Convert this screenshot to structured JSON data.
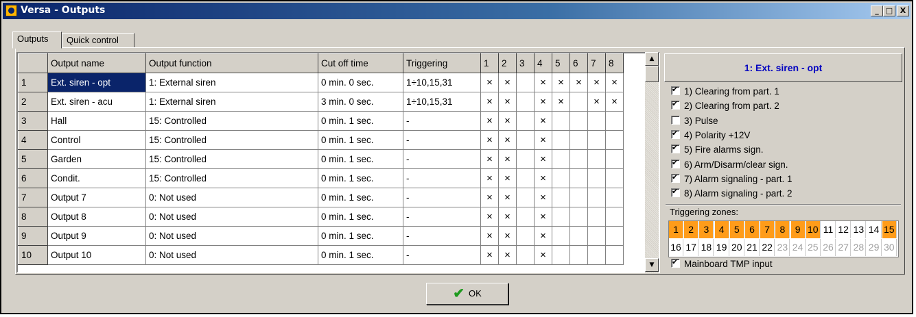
{
  "window": {
    "title": "Versa - Outputs",
    "controls": [
      "_",
      "□",
      "X"
    ]
  },
  "tabs": [
    {
      "label": "Outputs",
      "active": true
    },
    {
      "label": "Quick control",
      "active": false
    }
  ],
  "table": {
    "columns": [
      "",
      "Output name",
      "Output function",
      "Cut off time",
      "Triggering",
      "1",
      "2",
      "3",
      "4",
      "5",
      "6",
      "7",
      "8"
    ],
    "rows": [
      {
        "num": "1",
        "name": "Ext. siren - opt",
        "function": "1: External siren",
        "cutoff": "0 min. 0 sec.",
        "triggering": "1÷10,15,31",
        "marks": [
          "×",
          "×",
          "",
          "×",
          "×",
          "×",
          "×",
          "×"
        ]
      },
      {
        "num": "2",
        "name": "Ext. siren - acu",
        "function": "1: External siren",
        "cutoff": "3 min. 0 sec.",
        "triggering": "1÷10,15,31",
        "marks": [
          "×",
          "×",
          "",
          "×",
          "×",
          "",
          "×",
          "×"
        ]
      },
      {
        "num": "3",
        "name": "Hall",
        "function": "15: Controlled",
        "cutoff": "0 min. 1 sec.",
        "triggering": "-",
        "marks": [
          "×",
          "×",
          "",
          "×",
          "",
          "",
          "",
          ""
        ]
      },
      {
        "num": "4",
        "name": "Control",
        "function": "15: Controlled",
        "cutoff": "0 min. 1 sec.",
        "triggering": "-",
        "marks": [
          "×",
          "×",
          "",
          "×",
          "",
          "",
          "",
          ""
        ]
      },
      {
        "num": "5",
        "name": "Garden",
        "function": "15: Controlled",
        "cutoff": "0 min. 1 sec.",
        "triggering": "-",
        "marks": [
          "×",
          "×",
          "",
          "×",
          "",
          "",
          "",
          ""
        ]
      },
      {
        "num": "6",
        "name": "Condit.",
        "function": "15: Controlled",
        "cutoff": "0 min. 1 sec.",
        "triggering": "-",
        "marks": [
          "×",
          "×",
          "",
          "×",
          "",
          "",
          "",
          ""
        ]
      },
      {
        "num": "7",
        "name": "Output 7",
        "function": "0: Not used",
        "cutoff": "0 min. 1 sec.",
        "triggering": "-",
        "marks": [
          "×",
          "×",
          "",
          "×",
          "",
          "",
          "",
          ""
        ]
      },
      {
        "num": "8",
        "name": "Output 8",
        "function": "0: Not used",
        "cutoff": "0 min. 1 sec.",
        "triggering": "-",
        "marks": [
          "×",
          "×",
          "",
          "×",
          "",
          "",
          "",
          ""
        ]
      },
      {
        "num": "9",
        "name": "Output 9",
        "function": "0: Not used",
        "cutoff": "0 min. 1 sec.",
        "triggering": "-",
        "marks": [
          "×",
          "×",
          "",
          "×",
          "",
          "",
          "",
          ""
        ]
      },
      {
        "num": "10",
        "name": "Output 10",
        "function": "0: Not used",
        "cutoff": "0 min. 1 sec.",
        "triggering": "-",
        "marks": [
          "×",
          "×",
          "",
          "×",
          "",
          "",
          "",
          ""
        ]
      }
    ],
    "selected_row": 1
  },
  "side": {
    "header": "1: Ext. siren - opt",
    "options": [
      {
        "label": "1) Clearing from part. 1",
        "checked": true
      },
      {
        "label": "2) Clearing from part. 2",
        "checked": true
      },
      {
        "label": "3) Pulse",
        "checked": false
      },
      {
        "label": "4) Polarity +12V",
        "checked": true
      },
      {
        "label": "5) Fire alarms sign.",
        "checked": true
      },
      {
        "label": "6) Arm/Disarm/clear sign.",
        "checked": true
      },
      {
        "label": "7) Alarm signaling - part.  1",
        "checked": true
      },
      {
        "label": "8) Alarm signaling - part.  2",
        "checked": true
      }
    ],
    "zones_label": "Triggering zones:",
    "zones": [
      {
        "n": "1",
        "on": true
      },
      {
        "n": "2",
        "on": true
      },
      {
        "n": "3",
        "on": true
      },
      {
        "n": "4",
        "on": true
      },
      {
        "n": "5",
        "on": true
      },
      {
        "n": "6",
        "on": true
      },
      {
        "n": "7",
        "on": true
      },
      {
        "n": "8",
        "on": true
      },
      {
        "n": "9",
        "on": true
      },
      {
        "n": "10",
        "on": true
      },
      {
        "n": "11",
        "on": false
      },
      {
        "n": "12",
        "on": false
      },
      {
        "n": "13",
        "on": false
      },
      {
        "n": "14",
        "on": false
      },
      {
        "n": "15",
        "on": true
      },
      {
        "n": "16",
        "on": false
      },
      {
        "n": "17",
        "on": false
      },
      {
        "n": "18",
        "on": false
      },
      {
        "n": "19",
        "on": false
      },
      {
        "n": "20",
        "on": false
      },
      {
        "n": "21",
        "on": false
      },
      {
        "n": "22",
        "on": false
      },
      {
        "n": "23",
        "on": false,
        "dim": true
      },
      {
        "n": "24",
        "on": false,
        "dim": true
      },
      {
        "n": "25",
        "on": false,
        "dim": true
      },
      {
        "n": "26",
        "on": false,
        "dim": true
      },
      {
        "n": "27",
        "on": false,
        "dim": true
      },
      {
        "n": "28",
        "on": false,
        "dim": true
      },
      {
        "n": "29",
        "on": false,
        "dim": true
      },
      {
        "n": "30",
        "on": false,
        "dim": true
      }
    ],
    "tmp_label": "Mainboard TMP input",
    "tmp_checked": true
  },
  "ok_label": "OK",
  "colors": {
    "zone_on": "#ff9c1a",
    "title_bar": "#0a246a",
    "selection": "#0a246a",
    "header_text": "#0000c0"
  }
}
